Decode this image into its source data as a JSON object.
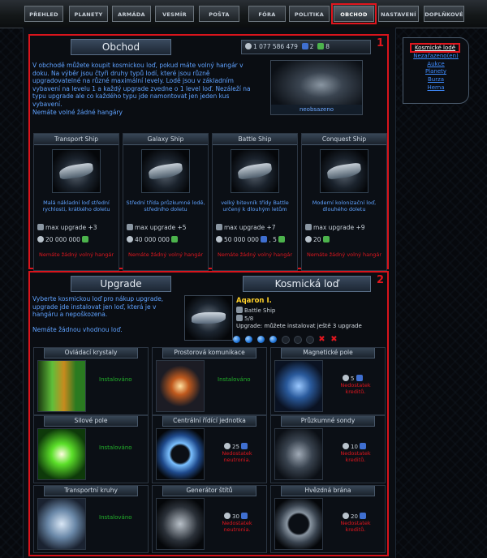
{
  "nav": {
    "tabs": [
      "PŘEHLED",
      "PLANETY",
      "ARMÁDA",
      "VESMÍR",
      "POŠTA",
      "FÓRA",
      "POLITIKA",
      "OBCHOD",
      "NASTAVENÍ",
      "DOPLŇKOVÉ"
    ],
    "active_index": 7
  },
  "sidebar": {
    "links": [
      "Kosmické lodě",
      "Nezařazeno(en)",
      "Aukce",
      "Planety",
      "Burza",
      "Herna"
    ],
    "active_index": 0
  },
  "shop": {
    "title": "Obchod",
    "box_number": "1",
    "credits": "1 077 586 479",
    "stat2": "2",
    "stat3": "8",
    "intro": "V obchodě můžete koupit kosmickou loď, pokud máte volný hangár v doku. Na výběr jsou čtyři druhy typů lodí, které jsou různě upgradovatelné na různé maximální levely. Lodě jsou v základním vybavení na levelu 1 a každý upgrade zvedne o 1 level loď. Nezáleží na typu upgrade ale co každého typu jde namontovat jen jeden kus vybavení.",
    "no_hangar": "Nemáte volné žádné hangáry",
    "image_label": "neobsazeno",
    "ships": [
      {
        "name": "Transport Ship",
        "desc": "Malá nákladní loď střední rychlosti, krátkého doletu",
        "upgrade": "max upgrade +3",
        "price": "20 000 000",
        "warn": "Nemáte žádný volný hangár"
      },
      {
        "name": "Galaxy Ship",
        "desc": "Střední třída průzkumné lodě, středního doletu",
        "upgrade": "max upgrade +5",
        "price": "40 000 000",
        "warn": "Nemáte žádný volný hangár"
      },
      {
        "name": "Battle Ship",
        "desc": "velký bitevník třídy Battle určený k dlouhým letům",
        "upgrade": "max upgrade +7",
        "price": "50 000 000",
        "price2": "5",
        "warn": "Nemáte žádný volný hangár"
      },
      {
        "name": "Conquest Ship",
        "desc": "Moderní kolonizační loď, dlouhého doletu",
        "upgrade": "max upgrade +9",
        "price": "20",
        "warn": "Nemáte žádný volný hangár"
      }
    ]
  },
  "upgrade": {
    "tab_left": "Upgrade",
    "tab_right": "Kosmická loď",
    "box_number": "2",
    "intro": "Vyberte kosmickou loď pro nákup upgrade, upgrade jde instalovat jen loď, která je v hangáru a nepoškozena.",
    "none": "Nemáte žádnou vhodnou loď.",
    "ship_name": "Aqaron I.",
    "ship_type": "Battle Ship",
    "ship_level": "5/8",
    "can_install": "Upgrade: můžete instalovat ještě 3 upgrade",
    "modules": [
      {
        "name": "Ovládací krystaly",
        "status": "installed",
        "installed_label": "Instalováno"
      },
      {
        "name": "Prostorová komunikace",
        "status": "installed",
        "installed_label": "Instalováno"
      },
      {
        "name": "Magnetické pole",
        "status": "buy",
        "price": "5",
        "lack": "Nedostatek kreditů."
      },
      {
        "name": "Silové pole",
        "status": "installed",
        "installed_label": "Instalováno"
      },
      {
        "name": "Centrální řídící jednotka",
        "status": "buy",
        "price": "25",
        "lack": "Nedostatek neutronia."
      },
      {
        "name": "Průzkumné sondy",
        "status": "buy",
        "price": "10",
        "lack": "Nedostatek kreditů."
      },
      {
        "name": "Transportní kruhy",
        "status": "installed",
        "installed_label": "Instalováno"
      },
      {
        "name": "Generátor štítů",
        "status": "buy",
        "price": "30",
        "lack": "Nedostatek neutronia."
      },
      {
        "name": "Hvězdná brána",
        "status": "buy",
        "price": "20",
        "lack": "Nedostatek kreditů."
      }
    ],
    "slot_states": [
      "on",
      "on",
      "on",
      "on",
      "off",
      "off",
      "off",
      "x",
      "x"
    ]
  },
  "colors": {
    "accent_red": "#e0161e",
    "text_blue": "#5fa2ff",
    "installed_green": "#22b02a"
  }
}
